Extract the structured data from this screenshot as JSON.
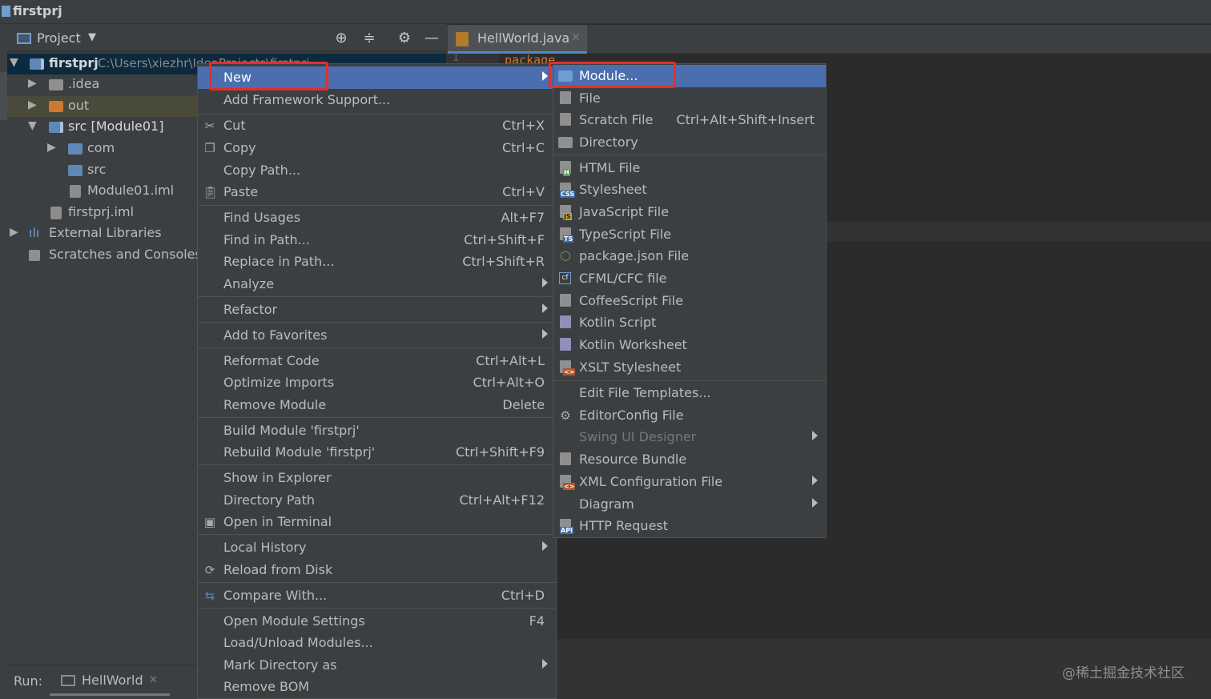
{
  "window": {
    "title": "firstprj"
  },
  "project_panel": {
    "label": "Project",
    "tree": [
      {
        "label": "firstprj",
        "path": "C:\\Users\\xiezhr\\IdeaProjects\\firstprj"
      },
      {
        "label": ".idea"
      },
      {
        "label": "out"
      },
      {
        "label": "src [Module01]"
      },
      {
        "label": "com"
      },
      {
        "label": "src"
      },
      {
        "label": "Module01.iml"
      },
      {
        "label": "firstprj.iml"
      },
      {
        "label": "External Libraries"
      },
      {
        "label": "Scratches and Consoles"
      }
    ]
  },
  "editor": {
    "tab_label": "HellWorld.java",
    "gutter_line": "1",
    "code_fragment": "package"
  },
  "run_bar": {
    "label": "Run:",
    "tab": "HellWorld"
  },
  "context_menu": [
    {
      "label": "New",
      "shortcut": "",
      "submenu": true
    },
    {
      "label": "Add Framework Support...",
      "shortcut": ""
    },
    {
      "label": "Cut",
      "shortcut": "Ctrl+X"
    },
    {
      "label": "Copy",
      "shortcut": "Ctrl+C"
    },
    {
      "label": "Copy Path...",
      "shortcut": ""
    },
    {
      "label": "Paste",
      "shortcut": "Ctrl+V"
    },
    {
      "label": "Find Usages",
      "shortcut": "Alt+F7"
    },
    {
      "label": "Find in Path...",
      "shortcut": "Ctrl+Shift+F"
    },
    {
      "label": "Replace in Path...",
      "shortcut": "Ctrl+Shift+R"
    },
    {
      "label": "Analyze",
      "shortcut": "",
      "submenu": true
    },
    {
      "label": "Refactor",
      "shortcut": "",
      "submenu": true
    },
    {
      "label": "Add to Favorites",
      "shortcut": "",
      "submenu": true
    },
    {
      "label": "Reformat Code",
      "shortcut": "Ctrl+Alt+L"
    },
    {
      "label": "Optimize Imports",
      "shortcut": "Ctrl+Alt+O"
    },
    {
      "label": "Remove Module",
      "shortcut": "Delete"
    },
    {
      "label": "Build Module 'firstprj'",
      "shortcut": ""
    },
    {
      "label": "Rebuild Module 'firstprj'",
      "shortcut": "Ctrl+Shift+F9"
    },
    {
      "label": "Show in Explorer",
      "shortcut": ""
    },
    {
      "label": "Directory Path",
      "shortcut": "Ctrl+Alt+F12"
    },
    {
      "label": "Open in Terminal",
      "shortcut": ""
    },
    {
      "label": "Local History",
      "shortcut": "",
      "submenu": true
    },
    {
      "label": "Reload from Disk",
      "shortcut": ""
    },
    {
      "label": "Compare With...",
      "shortcut": "Ctrl+D"
    },
    {
      "label": "Open Module Settings",
      "shortcut": "F4"
    },
    {
      "label": "Load/Unload Modules...",
      "shortcut": ""
    },
    {
      "label": "Mark Directory as",
      "shortcut": "",
      "submenu": true
    },
    {
      "label": "Remove BOM",
      "shortcut": ""
    }
  ],
  "new_submenu": [
    {
      "label": "Module...",
      "shortcut": ""
    },
    {
      "label": "File",
      "shortcut": ""
    },
    {
      "label": "Scratch File",
      "shortcut": "Ctrl+Alt+Shift+Insert"
    },
    {
      "label": "Directory",
      "shortcut": ""
    },
    {
      "label": "HTML File",
      "shortcut": ""
    },
    {
      "label": "Stylesheet",
      "shortcut": ""
    },
    {
      "label": "JavaScript File",
      "shortcut": ""
    },
    {
      "label": "TypeScript File",
      "shortcut": ""
    },
    {
      "label": "package.json File",
      "shortcut": ""
    },
    {
      "label": "CFML/CFC file",
      "shortcut": ""
    },
    {
      "label": "CoffeeScript File",
      "shortcut": ""
    },
    {
      "label": "Kotlin Script",
      "shortcut": ""
    },
    {
      "label": "Kotlin Worksheet",
      "shortcut": ""
    },
    {
      "label": "XSLT Stylesheet",
      "shortcut": ""
    },
    {
      "label": "Edit File Templates...",
      "shortcut": ""
    },
    {
      "label": "EditorConfig File",
      "shortcut": ""
    },
    {
      "label": "Swing UI Designer",
      "shortcut": "",
      "submenu": true
    },
    {
      "label": "Resource Bundle",
      "shortcut": ""
    },
    {
      "label": "XML Configuration File",
      "shortcut": "",
      "submenu": true
    },
    {
      "label": "Diagram",
      "shortcut": "",
      "submenu": true
    },
    {
      "label": "HTTP Request",
      "shortcut": ""
    }
  ],
  "icon_badges": {
    "html": "H",
    "css": "CSS",
    "js": "JS",
    "ts": "TS",
    "cfml": "cf",
    "api": "API"
  },
  "watermark": "@稀土掘金技术社区",
  "colors": {
    "highlight": "#4b6eaf",
    "annotation": "#e0302f",
    "background": "#2b2b2b",
    "panel": "#3c3f41"
  }
}
